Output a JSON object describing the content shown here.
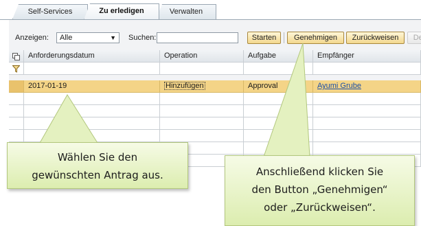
{
  "tabs": [
    {
      "label": "Self-Services"
    },
    {
      "label": "Zu erledigen"
    },
    {
      "label": "Verwalten"
    }
  ],
  "filter": {
    "show_label": "Anzeigen:",
    "show_value": "Alle",
    "search_label": "Suchen:",
    "search_value": ""
  },
  "toolbar": {
    "start_label": "Starten",
    "approve_label": "Genehmigen",
    "reject_label": "Zurückweisen",
    "delete_label": "Dele"
  },
  "table": {
    "columns": [
      "Anforderungsdatum",
      "Operation",
      "Aufgabe",
      "Empfänger"
    ],
    "rows": [
      {
        "date": "2017-01-19",
        "operation": "Hinzufügen",
        "task": "Approval",
        "recipient": "Ayumi Grube"
      }
    ]
  },
  "callouts": {
    "select_request_line1": "Wählen Sie den",
    "select_request_line2": "gewünschten Antrag aus.",
    "click_button_line1": "Anschließend klicken Sie",
    "click_button_line2": "den Button „Genehmigen“",
    "click_button_line3": "oder „Zurückweisen“."
  },
  "colors": {
    "selected_row": "#f4d487",
    "callout_fill": "#dcedaf",
    "link": "#1a4ea6"
  }
}
